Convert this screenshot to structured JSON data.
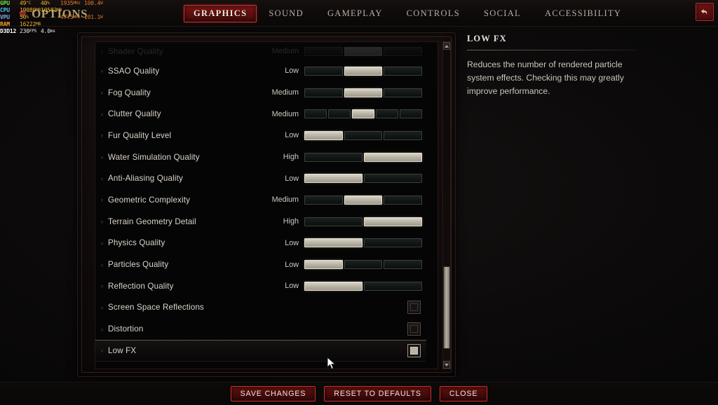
{
  "overlay": {
    "rows": [
      {
        "label": "GPU",
        "label_color": "#6fe04a",
        "a": "49",
        "a_unit": "°C",
        "b": "40",
        "b_unit": "%",
        "c": "1935",
        "c_unit": "MHz",
        "d": "100.4",
        "d_unit": "W"
      },
      {
        "label": "CPU",
        "label_color": "#49c2ec",
        "a": "19080",
        "a_unit": "MB",
        "b": "10582",
        "b_unit": "MB",
        "c": "",
        "c_unit": "",
        "d": "",
        "d_unit": ""
      },
      {
        "label": "VPU",
        "label_color": "#7fa8f0",
        "a": "50",
        "a_unit": "%",
        "b": "",
        "b_unit": "",
        "c": "4775",
        "c_unit": "MHz",
        "d": "101.1",
        "d_unit": "W"
      },
      {
        "label": "RAM",
        "label_color": "#f0a52a",
        "a": "16222",
        "a_unit": "MB",
        "b": "",
        "b_unit": "",
        "c": "",
        "c_unit": "",
        "d": "",
        "d_unit": ""
      },
      {
        "label": "D3D12",
        "label_color": "#ffffff",
        "a": "230",
        "a_unit": "FPS",
        "b": "4.0",
        "b_unit": "ms",
        "c": "",
        "c_unit": "",
        "d": "",
        "d_unit": ""
      }
    ]
  },
  "header": {
    "title": "OPTIONS",
    "ornament": "❖",
    "back_button_icon": "back-arrow-icon",
    "tabs": [
      {
        "label": "GRAPHICS",
        "active": true
      },
      {
        "label": "SOUND",
        "active": false
      },
      {
        "label": "GAMEPLAY",
        "active": false
      },
      {
        "label": "CONTROLS",
        "active": false
      },
      {
        "label": "SOCIAL",
        "active": false
      },
      {
        "label": "ACCESSIBILITY",
        "active": false
      }
    ]
  },
  "settings": {
    "rows": [
      {
        "label": "Shader Quality",
        "type": "slider",
        "value": "Medium",
        "segments": 3,
        "active_index": 1,
        "partial": true,
        "selected": false
      },
      {
        "label": "SSAO Quality",
        "type": "slider",
        "value": "Low",
        "segments": 3,
        "active_index": 1,
        "partial": false,
        "selected": false
      },
      {
        "label": "Fog Quality",
        "type": "slider",
        "value": "Medium",
        "segments": 3,
        "active_index": 1,
        "partial": false,
        "selected": false
      },
      {
        "label": "Clutter Quality",
        "type": "slider",
        "value": "Medium",
        "segments": 5,
        "active_index": 2,
        "partial": false,
        "selected": false
      },
      {
        "label": "Fur Quality Level",
        "type": "slider",
        "value": "Low",
        "segments": 3,
        "active_index": 0,
        "partial": false,
        "selected": false
      },
      {
        "label": "Water Simulation Quality",
        "type": "slider",
        "value": "High",
        "segments": 2,
        "active_index": 1,
        "partial": false,
        "selected": false
      },
      {
        "label": "Anti-Aliasing Quality",
        "type": "slider",
        "value": "Low",
        "segments": 2,
        "active_index": 0,
        "partial": false,
        "selected": false
      },
      {
        "label": "Geometric Complexity",
        "type": "slider",
        "value": "Medium",
        "segments": 3,
        "active_index": 1,
        "partial": false,
        "selected": false
      },
      {
        "label": "Terrain Geometry Detail",
        "type": "slider",
        "value": "High",
        "segments": 2,
        "active_index": 1,
        "partial": false,
        "selected": false
      },
      {
        "label": "Physics Quality",
        "type": "slider",
        "value": "Low",
        "segments": 2,
        "active_index": 0,
        "partial": false,
        "selected": false
      },
      {
        "label": "Particles Quality",
        "type": "slider",
        "value": "Low",
        "segments": 3,
        "active_index": 0,
        "partial": false,
        "selected": false
      },
      {
        "label": "Reflection Quality",
        "type": "slider",
        "value": "Low",
        "segments": 2,
        "active_index": 0,
        "partial": false,
        "selected": false
      },
      {
        "label": "Screen Space Reflections",
        "type": "checkbox",
        "value": "",
        "checked": false,
        "partial": false,
        "selected": false
      },
      {
        "label": "Distortion",
        "type": "checkbox",
        "value": "",
        "checked": false,
        "partial": false,
        "selected": false
      },
      {
        "label": "Low FX",
        "type": "checkbox",
        "value": "",
        "checked": false,
        "partial": false,
        "selected": true
      }
    ],
    "row_arrow": "›",
    "scrollbar": {
      "up_icon": "chevron-up-icon",
      "down_icon": "chevron-down-icon"
    }
  },
  "description": {
    "title": "LOW FX",
    "body": "Reduces the number of rendered particle system effects. Checking this may greatly improve performance."
  },
  "footer": {
    "buttons": [
      {
        "label": "SAVE CHANGES"
      },
      {
        "label": "RESET TO DEFAULTS"
      },
      {
        "label": "CLOSE"
      }
    ]
  },
  "colors": {
    "accent_red": "#cf2f28",
    "tab_active_bg": "#5d0e0e",
    "slider_on": "#c9c4b5",
    "text_primary": "#d9d4cc"
  }
}
